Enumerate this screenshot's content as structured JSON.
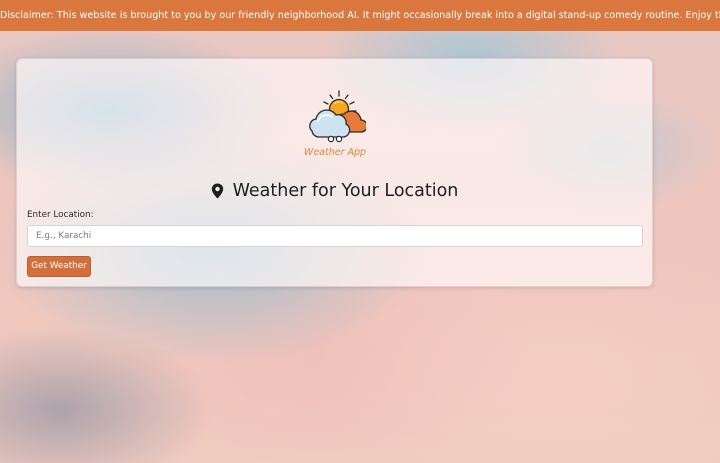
{
  "banner": {
    "text": "Disclaimer: This website is brought to you by our friendly neighborhood AI. It might occasionally break into a digital stand-up comedy routine. Enjoy the virtual chuckles! 🤗"
  },
  "logo": {
    "text": "Weather App"
  },
  "main": {
    "heading": "Weather for Your Location",
    "location_label": "Enter Location:",
    "location_value": "",
    "location_placeholder": "E.g., Karachi",
    "submit_label": "Get Weather"
  },
  "icons": {
    "logo": "weather-cloud-sun-icon",
    "heading": "map-pin-icon"
  },
  "colors": {
    "banner": "#d9773f",
    "button": "#d46f3b",
    "logo_text": "#de8540"
  }
}
